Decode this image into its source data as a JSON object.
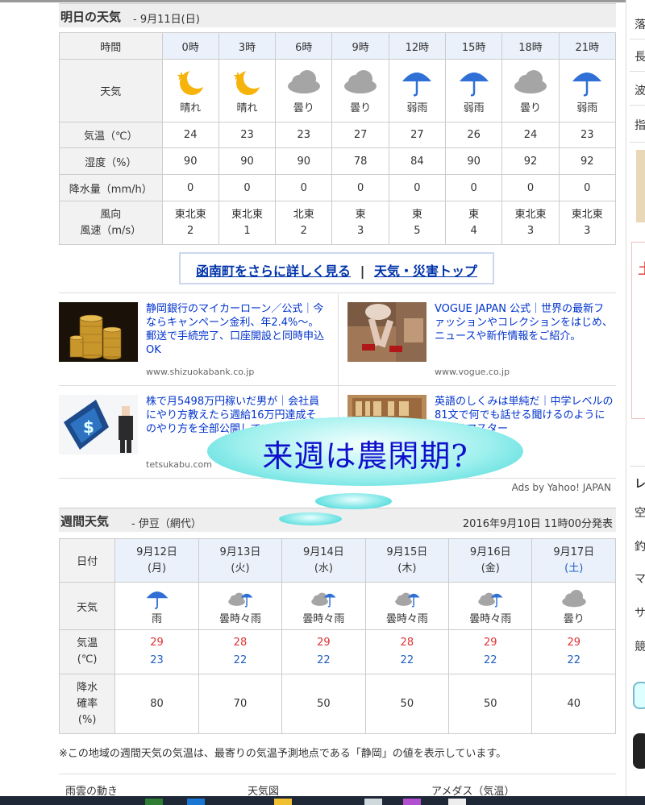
{
  "tomorrow": {
    "title": "明日の天気",
    "date": "- 9月11日(日)",
    "row_labels": {
      "time": "時間",
      "weather": "天気",
      "temp": "気温（℃）",
      "humidity": "湿度（%）",
      "precip": "降水量（mm/h）",
      "wind_dir": "風向",
      "wind_speed": "風速（m/s）"
    },
    "hours": [
      "0時",
      "3時",
      "6時",
      "9時",
      "12時",
      "15時",
      "18時",
      "21時"
    ],
    "weather": [
      {
        "icon": "moon-icon",
        "label": "晴れ"
      },
      {
        "icon": "moon-icon",
        "label": "晴れ"
      },
      {
        "icon": "cloud-icon",
        "label": "曇り"
      },
      {
        "icon": "cloud-icon",
        "label": "曇り"
      },
      {
        "icon": "umbrella-icon",
        "label": "弱雨"
      },
      {
        "icon": "umbrella-icon",
        "label": "弱雨"
      },
      {
        "icon": "cloud-icon",
        "label": "曇り"
      },
      {
        "icon": "umbrella-icon",
        "label": "弱雨"
      }
    ],
    "temps": [
      "24",
      "23",
      "23",
      "27",
      "27",
      "26",
      "24",
      "23"
    ],
    "humidity": [
      "90",
      "90",
      "90",
      "78",
      "84",
      "90",
      "92",
      "92"
    ],
    "precip": [
      "0",
      "0",
      "0",
      "0",
      "0",
      "0",
      "0",
      "0"
    ],
    "wind_dir": [
      "東北東",
      "東北東",
      "北東",
      "東",
      "東",
      "東",
      "東北東",
      "東北東"
    ],
    "wind_speed": [
      "2",
      "1",
      "2",
      "3",
      "5",
      "4",
      "3",
      "3"
    ]
  },
  "links": {
    "detail": "函南町をさらに詳しく見る",
    "separator": "|",
    "top": "天気・災害トップ"
  },
  "ads": [
    {
      "text": "静岡銀行のマイカーローン／公式｜今ならキャンペーン金利、年2.4%〜。郵送で手続完了、口座開設と同時申込OK",
      "url": "www.shizuokabank.co.jp"
    },
    {
      "text": "VOGUE JAPAN 公式｜世界の最新ファッションやコレクションをはじめ、ニュースや新作情報をご紹介。",
      "url": "www.vogue.co.jp"
    },
    {
      "text": "株で月5498万円稼いだ男が｜会社員にやり方教えたら週給16万円達成そのやり方を全部公開しててます！",
      "url": "tetsukabu.com"
    },
    {
      "text": "英語のしくみは単純だ｜中学レベルの81文で何でも話せる聞けるのように英語はマスター",
      "url": ""
    }
  ],
  "ads_by": "Ads by Yahoo! JAPAN",
  "overlay": "来週は農閑期?",
  "weekly": {
    "title": "週間天気",
    "region": "- 伊豆（網代）",
    "issued": "2016年9月10日 11時00分発表",
    "row_labels": {
      "date": "日付",
      "weather": "天気",
      "temp1": "気温",
      "temp2": "(℃)",
      "pop1": "降水",
      "pop2": "確率",
      "pop3": "(%)"
    },
    "days": [
      {
        "date": "9月12日",
        "dow": "(月)",
        "icon": "umbrella-icon",
        "label": "雨",
        "high": "29",
        "low": "23",
        "pop": "80"
      },
      {
        "date": "9月13日",
        "dow": "(火)",
        "icon": "cloud-umbrella-icon",
        "label": "曇時々雨",
        "high": "28",
        "low": "22",
        "pop": "70"
      },
      {
        "date": "9月14日",
        "dow": "(水)",
        "icon": "cloud-umbrella-icon",
        "label": "曇時々雨",
        "high": "29",
        "low": "22",
        "pop": "50"
      },
      {
        "date": "9月15日",
        "dow": "(木)",
        "icon": "cloud-umbrella-icon",
        "label": "曇時々雨",
        "high": "28",
        "low": "22",
        "pop": "50"
      },
      {
        "date": "9月16日",
        "dow": "(金)",
        "icon": "cloud-umbrella-icon",
        "label": "曇時々雨",
        "high": "29",
        "low": "22",
        "pop": "50"
      },
      {
        "date": "9月17日",
        "dow": "(土)",
        "icon": "cloud-icon",
        "label": "曇り",
        "high": "29",
        "low": "22",
        "pop": "40"
      }
    ],
    "note": "※この地域の週間天気の気温は、最寄りの気温予測地点である「静岡」の値を表示しています。"
  },
  "footer_tabs": [
    "雨雲の動き",
    "天気図",
    "アメダス（気温）"
  ],
  "right_column": [
    "落",
    "長",
    "波",
    "指",
    "レ",
    "空",
    "釣",
    "マ",
    "サ",
    "競"
  ]
}
